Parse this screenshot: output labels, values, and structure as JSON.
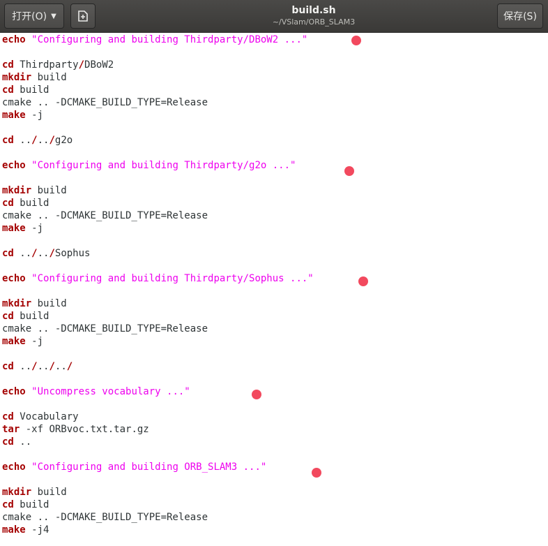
{
  "header": {
    "open_label": "打开(O)",
    "save_label": "保存(S)",
    "title": "build.sh",
    "subtitle": "~/VSlam/ORB_SLAM3",
    "new_tab_icon": "new-document-icon"
  },
  "dot_color": "#f2495e",
  "lines": [
    [
      [
        "kw",
        "echo"
      ],
      [
        "t",
        " "
      ],
      [
        "str",
        "\"Configuring and building Thirdparty/DBoW2 ...\""
      ]
    ],
    [],
    [
      [
        "kw",
        "cd"
      ],
      [
        "t",
        " Thirdparty"
      ],
      [
        "slash",
        "/"
      ],
      [
        "t",
        "DBoW2"
      ]
    ],
    [
      [
        "kw",
        "mkdir"
      ],
      [
        "t",
        " build"
      ]
    ],
    [
      [
        "kw",
        "cd"
      ],
      [
        "t",
        " build"
      ]
    ],
    [
      [
        "t",
        "cmake .. -DCMAKE_BUILD_TYPE=Release"
      ]
    ],
    [
      [
        "kw",
        "make"
      ],
      [
        "t",
        " -j"
      ]
    ],
    [],
    [
      [
        "kw",
        "cd"
      ],
      [
        "t",
        " .."
      ],
      [
        "slash",
        "/"
      ],
      [
        "t",
        ".."
      ],
      [
        "slash",
        "/"
      ],
      [
        "t",
        "g2o"
      ]
    ],
    [],
    [
      [
        "kw",
        "echo"
      ],
      [
        "t",
        " "
      ],
      [
        "str",
        "\"Configuring and building Thirdparty/g2o ...\""
      ]
    ],
    [],
    [
      [
        "kw",
        "mkdir"
      ],
      [
        "t",
        " build"
      ]
    ],
    [
      [
        "kw",
        "cd"
      ],
      [
        "t",
        " build"
      ]
    ],
    [
      [
        "t",
        "cmake .. -DCMAKE_BUILD_TYPE=Release"
      ]
    ],
    [
      [
        "kw",
        "make"
      ],
      [
        "t",
        " -j"
      ]
    ],
    [],
    [
      [
        "kw",
        "cd"
      ],
      [
        "t",
        " .."
      ],
      [
        "slash",
        "/"
      ],
      [
        "t",
        ".."
      ],
      [
        "slash",
        "/"
      ],
      [
        "t",
        "Sophus"
      ]
    ],
    [],
    [
      [
        "kw",
        "echo"
      ],
      [
        "t",
        " "
      ],
      [
        "str",
        "\"Configuring and building Thirdparty/Sophus ...\""
      ]
    ],
    [],
    [
      [
        "kw",
        "mkdir"
      ],
      [
        "t",
        " build"
      ]
    ],
    [
      [
        "kw",
        "cd"
      ],
      [
        "t",
        " build"
      ]
    ],
    [
      [
        "t",
        "cmake .. -DCMAKE_BUILD_TYPE=Release"
      ]
    ],
    [
      [
        "kw",
        "make"
      ],
      [
        "t",
        " -j"
      ]
    ],
    [],
    [
      [
        "kw",
        "cd"
      ],
      [
        "t",
        " .."
      ],
      [
        "slash",
        "/"
      ],
      [
        "t",
        ".."
      ],
      [
        "slash",
        "/"
      ],
      [
        "t",
        ".."
      ],
      [
        "slash",
        "/"
      ]
    ],
    [],
    [
      [
        "kw",
        "echo"
      ],
      [
        "t",
        " "
      ],
      [
        "str",
        "\"Uncompress vocabulary ...\""
      ]
    ],
    [],
    [
      [
        "kw",
        "cd"
      ],
      [
        "t",
        " Vocabulary"
      ]
    ],
    [
      [
        "kw",
        "tar"
      ],
      [
        "t",
        " -xf ORBvoc.txt.tar.gz"
      ]
    ],
    [
      [
        "kw",
        "cd"
      ],
      [
        "t",
        " .."
      ]
    ],
    [],
    [
      [
        "kw",
        "echo"
      ],
      [
        "t",
        " "
      ],
      [
        "str",
        "\"Configuring and building ORB_SLAM3 ...\""
      ]
    ],
    [],
    [
      [
        "kw",
        "mkdir"
      ],
      [
        "t",
        " build"
      ]
    ],
    [
      [
        "kw",
        "cd"
      ],
      [
        "t",
        " build"
      ]
    ],
    [
      [
        "t",
        "cmake .. -DCMAKE_BUILD_TYPE=Release"
      ]
    ],
    [
      [
        "kw",
        "make"
      ],
      [
        "t",
        " -j4"
      ]
    ]
  ]
}
